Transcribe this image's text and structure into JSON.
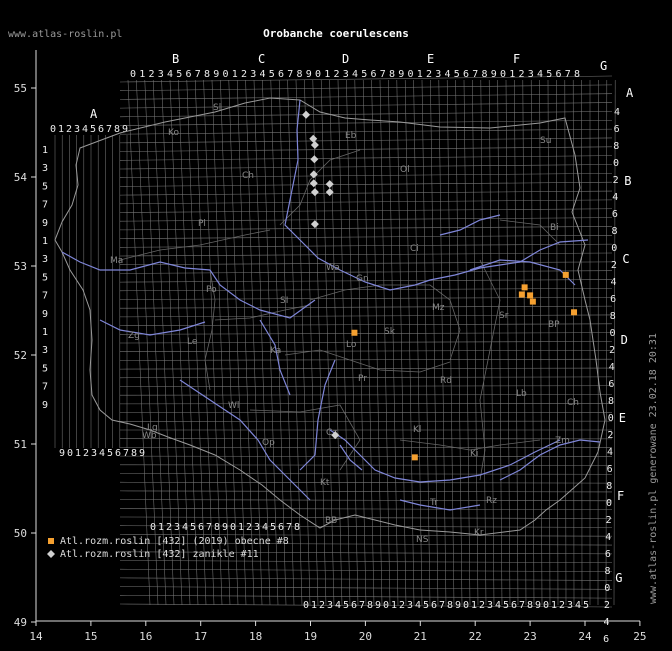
{
  "title": "Orobanche coerulescens",
  "site_label": "www.atlas-roslin.pl",
  "footer_label": "www.atlas-roslin.pl generowane 23.02.18 20:31",
  "x_axis": {
    "ticks": [
      "14",
      "15",
      "16",
      "17",
      "18",
      "19",
      "20",
      "21",
      "22",
      "23",
      "24",
      "25"
    ]
  },
  "y_axis": {
    "ticks": [
      "55",
      "54",
      "53",
      "52",
      "51",
      "50",
      "49"
    ]
  },
  "grid_letters": {
    "top": [
      "B",
      "C",
      "D",
      "E",
      "F",
      "G"
    ],
    "left_top": [
      "A"
    ],
    "right": [
      "A",
      "B",
      "C",
      "D",
      "E",
      "F",
      "G"
    ]
  },
  "digit_rows": {
    "top_main": "0123456789012345678901234567890123456789012345678",
    "top_left": "0123456789",
    "left_bottom": "90123456789",
    "bottom_left": "0123456789012345678",
    "bottom_main": "012345678901234567890123456789012345",
    "left_column": [
      "1",
      "3",
      "5",
      "7",
      "9",
      "1",
      "3",
      "5",
      "7",
      "9",
      "1",
      "3",
      "5",
      "7",
      "9"
    ],
    "right_column": [
      "4",
      "6",
      "8",
      "0",
      "2",
      "4",
      "6",
      "8",
      "0",
      "2",
      "4",
      "6",
      "8",
      "0",
      "2",
      "4",
      "6",
      "8",
      "0",
      "2",
      "4",
      "6",
      "8",
      "0",
      "2",
      "4",
      "6",
      "8",
      "0",
      "2",
      "4",
      "6",
      "8"
    ]
  },
  "region_labels": [
    "Sl",
    "Ko",
    "Eb",
    "Su",
    "Ol",
    "Ch",
    "Bi",
    "Pl",
    "Ci",
    "Ma",
    "Wa",
    "Gn",
    "Mz",
    "Sr",
    "Po",
    "SI",
    "BP",
    "Zg",
    "Le",
    "Ka",
    "Lo",
    "Sk",
    "Wl",
    "Pr",
    "Rd",
    "Lb",
    "Ch",
    "Lg",
    "Wb",
    "Cz",
    "Kl",
    "Zm",
    "Op",
    "Ki",
    "Kt",
    "Tr",
    "Rz",
    "BB",
    "NS",
    "Kr"
  ],
  "legend": [
    {
      "label": "Atl.rozm.roslin [432] (2019) obecne #8",
      "color": "#f5a030",
      "shape": "square"
    },
    {
      "label": "Atl.rozm.roslin [432] zanikle #11",
      "color": "#d0d0d0",
      "shape": "diamond"
    }
  ],
  "records_present": [
    {
      "lon": 19.8,
      "lat": 52.25
    },
    {
      "lon": 20.9,
      "lat": 50.85
    },
    {
      "lon": 22.9,
      "lat": 52.76
    },
    {
      "lon": 22.85,
      "lat": 52.68
    },
    {
      "lon": 23.0,
      "lat": 52.67
    },
    {
      "lon": 23.05,
      "lat": 52.6
    },
    {
      "lon": 23.65,
      "lat": 52.9
    },
    {
      "lon": 23.8,
      "lat": 52.48
    }
  ],
  "records_extinct": [
    {
      "lon": 18.92,
      "lat": 54.7
    },
    {
      "lon": 19.05,
      "lat": 54.43
    },
    {
      "lon": 19.08,
      "lat": 54.36
    },
    {
      "lon": 19.07,
      "lat": 54.2
    },
    {
      "lon": 19.06,
      "lat": 54.03
    },
    {
      "lon": 19.06,
      "lat": 53.93
    },
    {
      "lon": 19.08,
      "lat": 53.83
    },
    {
      "lon": 19.35,
      "lat": 53.92
    },
    {
      "lon": 19.35,
      "lat": 53.83
    },
    {
      "lon": 19.08,
      "lat": 53.47
    },
    {
      "lon": 19.45,
      "lat": 51.1
    }
  ]
}
